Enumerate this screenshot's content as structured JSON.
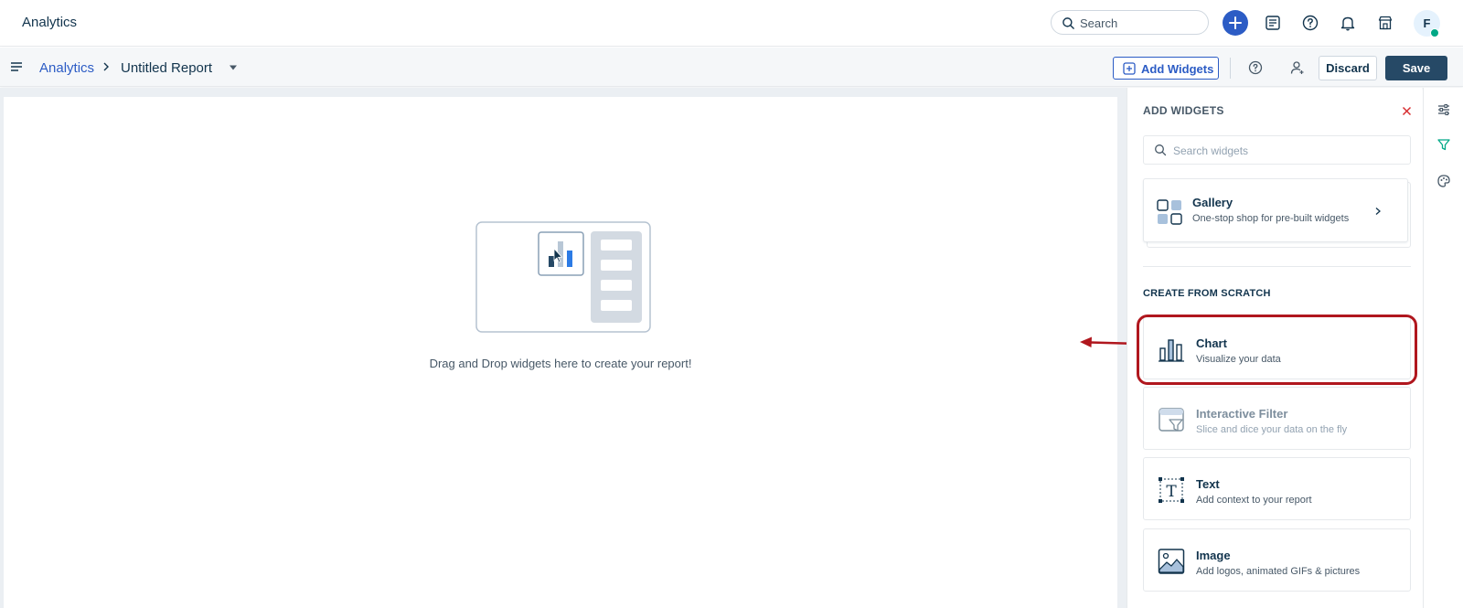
{
  "app": {
    "title": "Analytics"
  },
  "topbar": {
    "search_label": "Search",
    "avatar_initial": "F",
    "colors": {
      "primary": "#2c5cc5",
      "online": "#00a886"
    }
  },
  "toolbar": {
    "breadcrumb_root": "Analytics",
    "report_name": "Untitled Report",
    "add_widgets_label": "Add Widgets",
    "discard_label": "Discard",
    "save_label": "Save"
  },
  "canvas": {
    "empty_message": "Drag and Drop widgets here to create your report!"
  },
  "panel": {
    "title": "ADD WIDGETS",
    "search_placeholder": "Search widgets",
    "gallery": {
      "title": "Gallery",
      "subtitle": "One-stop shop for pre-built widgets"
    },
    "section_title": "CREATE FROM SCRATCH",
    "widgets": [
      {
        "title": "Chart",
        "subtitle": "Visualize your data",
        "icon": "bar-chart-icon",
        "disabled": false
      },
      {
        "title": "Interactive Filter",
        "subtitle": "Slice and dice your data on the fly",
        "icon": "filter-icon",
        "disabled": true
      },
      {
        "title": "Text",
        "subtitle": "Add context to your report",
        "icon": "text-icon",
        "disabled": false
      },
      {
        "title": "Image",
        "subtitle": "Add logos, animated GIFs & pictures",
        "icon": "image-icon",
        "disabled": false
      }
    ]
  },
  "annotation": {
    "highlight_color": "#b0171e"
  }
}
